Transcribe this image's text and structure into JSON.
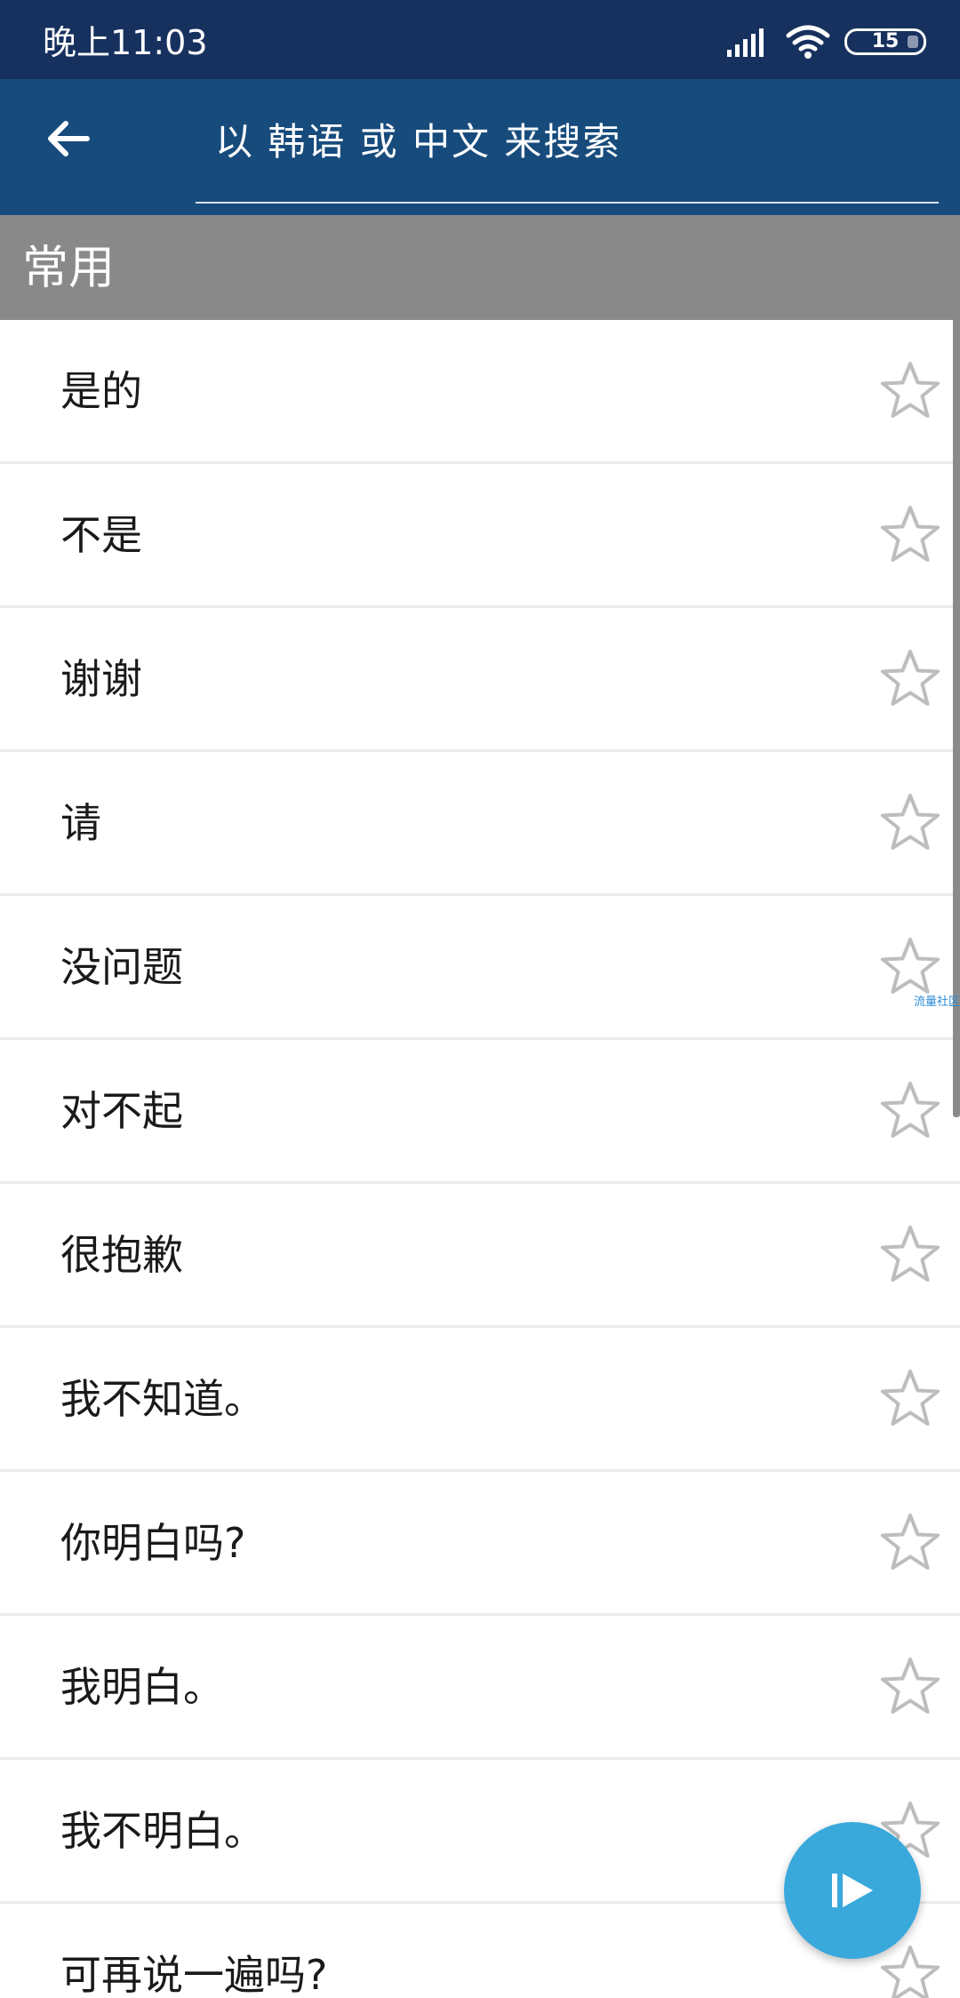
{
  "status_bar": {
    "time": "晚上11:03",
    "battery_level": "15"
  },
  "app_bar": {
    "search_placeholder": "以 韩语 或 中文 来搜索"
  },
  "section": {
    "title": "常用"
  },
  "phrases": [
    {
      "text": "是的"
    },
    {
      "text": "不是"
    },
    {
      "text": "谢谢"
    },
    {
      "text": "请"
    },
    {
      "text": "没问题"
    },
    {
      "text": "对不起"
    },
    {
      "text": "很抱歉"
    },
    {
      "text": "我不知道。"
    },
    {
      "text": "你明白吗?"
    },
    {
      "text": "我明白。"
    },
    {
      "text": "我不明白。"
    },
    {
      "text": "可再说一遍吗?"
    }
  ],
  "watermark": "流量社区",
  "colors": {
    "status_bar": "#17315f",
    "app_bar": "#174b7c",
    "section_header": "#898989",
    "fab": "#39a9dc",
    "star_outline": "#bdbdbd"
  },
  "icons": {
    "back": "arrow-left-icon",
    "favorite": "star-outline-icon",
    "play": "play-icon"
  }
}
